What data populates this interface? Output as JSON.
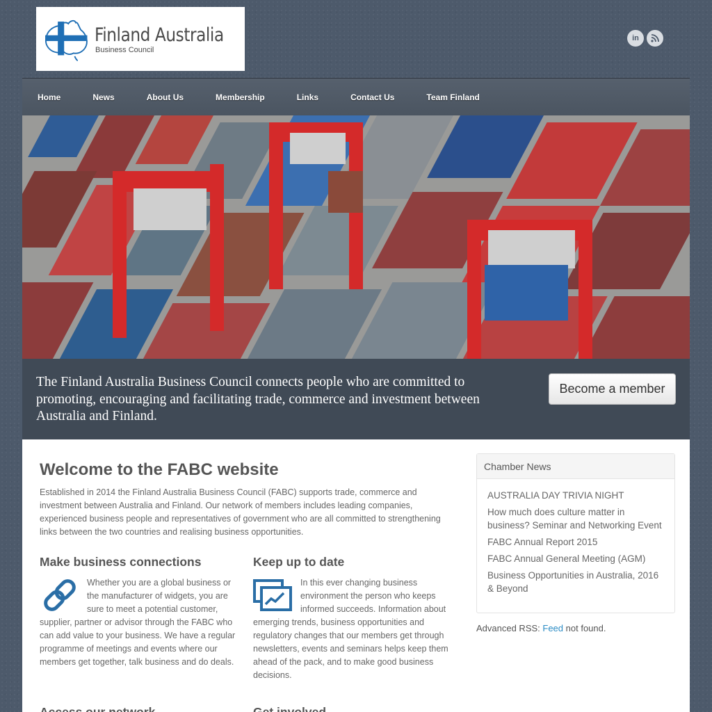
{
  "header": {
    "logo_title": "Finland Australia",
    "logo_subtitle": "Business Council",
    "social": [
      {
        "icon": "linkedin-icon",
        "label": "in"
      },
      {
        "icon": "rss-icon",
        "label": ""
      }
    ]
  },
  "nav": [
    "Home",
    "News",
    "About Us",
    "Membership",
    "Links",
    "Contact Us",
    "Team Finland"
  ],
  "tagline": "The Finland Australia Business Council connects people who are committed to promoting, encouraging and facilitating trade, commerce and investment between Australia and Finland.",
  "become_member": "Become a member",
  "main": {
    "title": "Welcome to the FABC website",
    "intro": "Established in 2014 the Finland Australia Business Council (FABC) supports trade, commerce and investment between Australia and Finland. Our network of members includes leading companies, experienced business people and representatives of government who are all committed to strengthening links between the two countries and realising business opportunities.",
    "col_left": {
      "title": "Make business connections",
      "body": "Whether you are a global business or the manufacturer of widgets, you are sure to meet a potential customer, supplier, partner or advisor through the FABC who can add value to your business.  We have a regular programme of meetings and events where our members get together, talk business and do deals.",
      "next_title": "Access our network"
    },
    "col_right": {
      "title": "Keep up to date",
      "body": "In this ever changing business environment the person who keeps informed succeeds.  Information about emerging trends, business opportunities and regulatory changes that our members get through newsletters, events and seminars helps keep them ahead of the pack, and to make good business decisions.",
      "next_title": "Get involved"
    }
  },
  "sidebar": {
    "title": "Chamber News",
    "items": [
      "AUSTRALIA DAY TRIVIA NIGHT",
      "How much does culture matter in business? Seminar and Networking Event",
      "FABC Annual Report 2015",
      "FABC Annual General Meeting (AGM)",
      "Business Opportunities in Australia, 2016 & Beyond"
    ],
    "rss_prefix": "Advanced RSS: ",
    "rss_link": "Feed",
    "rss_suffix": " not found."
  },
  "colors": {
    "accent": "#2a6ea6",
    "nav_bg": "#4b5561",
    "link": "#2a8bc4"
  }
}
